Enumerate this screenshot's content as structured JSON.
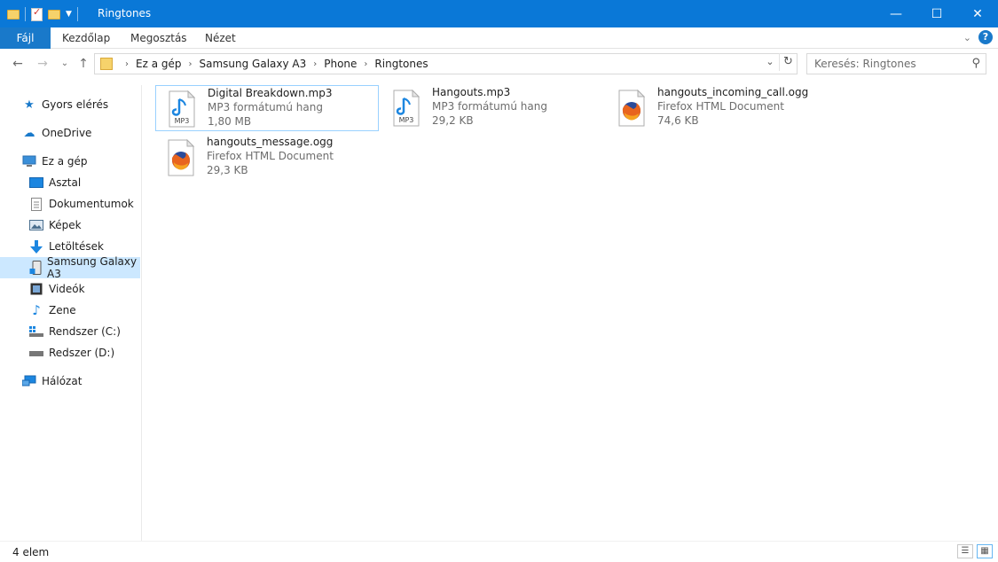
{
  "window": {
    "title": "Ringtones",
    "controls": {
      "minimize": "—",
      "maximize": "☐",
      "close": "✕"
    }
  },
  "ribbon": {
    "tabs": [
      "Fájl",
      "Kezdőlap",
      "Megosztás",
      "Nézet"
    ],
    "help_glyph": "?",
    "collapse_glyph": "⌄"
  },
  "navigation": {
    "back": "←",
    "forward": "→",
    "recent": "⌄",
    "up": "↑"
  },
  "address": {
    "breadcrumbs": [
      "Ez a gép",
      "Samsung Galaxy A3",
      "Phone",
      "Ringtones"
    ],
    "separator": "›",
    "dropdown_glyph": "⌄",
    "refresh_glyph": "↻"
  },
  "search": {
    "placeholder": "Keresés: Ringtones",
    "icon_glyph": "⚲"
  },
  "sidebar": {
    "items": [
      {
        "label": "Gyors elérés",
        "icon": "star-icon",
        "glyph": "★",
        "color": "#1979ca"
      },
      {
        "label": "OneDrive",
        "icon": "cloud-icon",
        "glyph": "☁",
        "color": "#1979ca"
      },
      {
        "label": "Ez a gép",
        "icon": "computer-icon",
        "glyph": "▭",
        "color": "#3a8fd9"
      },
      {
        "label": "Asztal",
        "icon": "desktop-icon",
        "glyph": "▬",
        "color": "#1c86e0"
      },
      {
        "label": "Dokumentumok",
        "icon": "document-icon",
        "glyph": "▤",
        "color": "#6d6d6d"
      },
      {
        "label": "Képek",
        "icon": "pictures-icon",
        "glyph": "▦",
        "color": "#4b6f8f"
      },
      {
        "label": "Letöltések",
        "icon": "download-icon",
        "glyph": "⬇",
        "color": "#1c86e0"
      },
      {
        "label": "Samsung Galaxy A3",
        "icon": "phone-icon",
        "glyph": "▯",
        "color": "#4a4a4a"
      },
      {
        "label": "Videók",
        "icon": "video-icon",
        "glyph": "▣",
        "color": "#333333"
      },
      {
        "label": "Zene",
        "icon": "music-icon",
        "glyph": "♪",
        "color": "#1c86e0"
      },
      {
        "label": "Rendszer (C:)",
        "icon": "drive-c-icon",
        "glyph": "▭",
        "color": "#555555"
      },
      {
        "label": "Redszer (D:)",
        "icon": "drive-d-icon",
        "glyph": "▭",
        "color": "#555555"
      },
      {
        "label": "Hálózat",
        "icon": "network-icon",
        "glyph": "⌂",
        "color": "#1c86e0"
      }
    ],
    "selected": "Samsung Galaxy A3"
  },
  "files": [
    {
      "name": "Digital Breakdown.mp3",
      "type": "MP3 formátumú hang",
      "size": "1,80 MB",
      "icon": "mp3-file-icon"
    },
    {
      "name": "Hangouts.mp3",
      "type": "MP3 formátumú hang",
      "size": "29,2 KB",
      "icon": "mp3-file-icon"
    },
    {
      "name": "hangouts_incoming_call.ogg",
      "type": "Firefox HTML Document",
      "size": "74,6 KB",
      "icon": "firefox-file-icon"
    },
    {
      "name": "hangouts_message.ogg",
      "type": "Firefox HTML Document",
      "size": "29,3 KB",
      "icon": "firefox-file-icon"
    }
  ],
  "selected_file": "Digital Breakdown.mp3",
  "mp3_badge": "MP3",
  "status": {
    "count": "4 elem",
    "details_view_glyph": "☰",
    "tiles_view_glyph": "▦"
  },
  "colors": {
    "titlebar": "#0a78d7",
    "file_tab": "#1979ca",
    "selection": "#cce8ff",
    "selection_border": "#99d1ff"
  }
}
